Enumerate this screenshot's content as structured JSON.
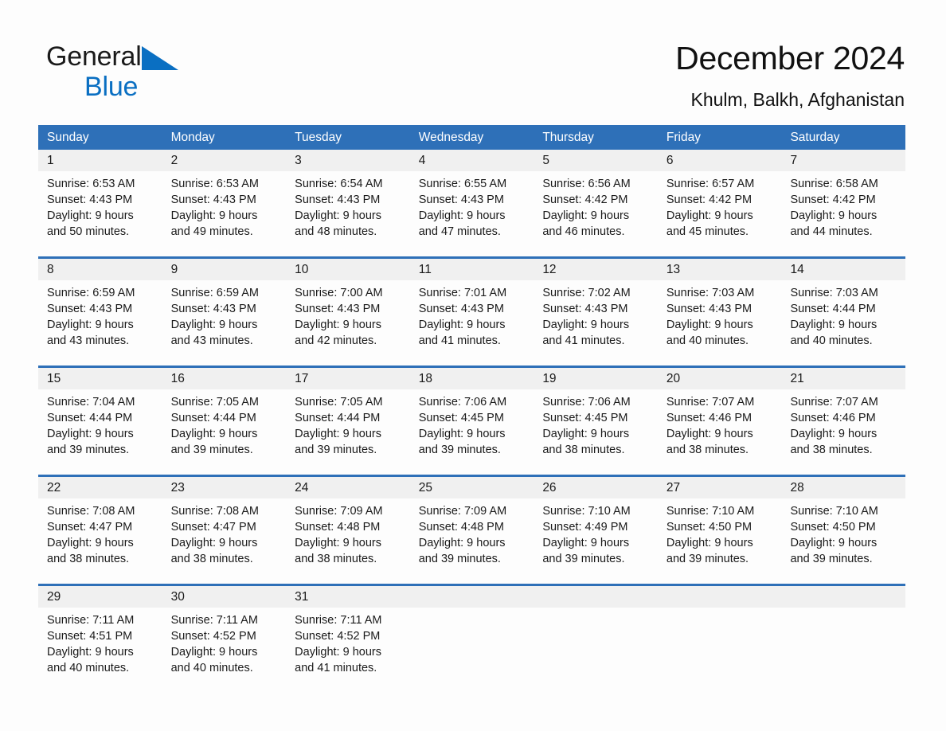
{
  "brand": {
    "name_part1": "General",
    "name_part2": "Blue",
    "triangle_icon": "blue-triangle-icon",
    "accent_color": "#0a6fc2"
  },
  "header": {
    "title": "December 2024",
    "subtitle": "Khulm, Balkh, Afghanistan"
  },
  "theme": {
    "header_blue": "#2e70b8",
    "date_strip_gray": "#f0f0f0",
    "page_background": "#fdfdfd",
    "text_color": "#1a1a1a"
  },
  "calendar": {
    "weekday_headers": [
      "Sunday",
      "Monday",
      "Tuesday",
      "Wednesday",
      "Thursday",
      "Friday",
      "Saturday"
    ],
    "weeks": [
      {
        "days": [
          {
            "date": "1",
            "sunrise": "Sunrise: 6:53 AM",
            "sunset": "Sunset: 4:43 PM",
            "daylight_line1": "Daylight: 9 hours",
            "daylight_line2": "and 50 minutes."
          },
          {
            "date": "2",
            "sunrise": "Sunrise: 6:53 AM",
            "sunset": "Sunset: 4:43 PM",
            "daylight_line1": "Daylight: 9 hours",
            "daylight_line2": "and 49 minutes."
          },
          {
            "date": "3",
            "sunrise": "Sunrise: 6:54 AM",
            "sunset": "Sunset: 4:43 PM",
            "daylight_line1": "Daylight: 9 hours",
            "daylight_line2": "and 48 minutes."
          },
          {
            "date": "4",
            "sunrise": "Sunrise: 6:55 AM",
            "sunset": "Sunset: 4:43 PM",
            "daylight_line1": "Daylight: 9 hours",
            "daylight_line2": "and 47 minutes."
          },
          {
            "date": "5",
            "sunrise": "Sunrise: 6:56 AM",
            "sunset": "Sunset: 4:42 PM",
            "daylight_line1": "Daylight: 9 hours",
            "daylight_line2": "and 46 minutes."
          },
          {
            "date": "6",
            "sunrise": "Sunrise: 6:57 AM",
            "sunset": "Sunset: 4:42 PM",
            "daylight_line1": "Daylight: 9 hours",
            "daylight_line2": "and 45 minutes."
          },
          {
            "date": "7",
            "sunrise": "Sunrise: 6:58 AM",
            "sunset": "Sunset: 4:42 PM",
            "daylight_line1": "Daylight: 9 hours",
            "daylight_line2": "and 44 minutes."
          }
        ]
      },
      {
        "days": [
          {
            "date": "8",
            "sunrise": "Sunrise: 6:59 AM",
            "sunset": "Sunset: 4:43 PM",
            "daylight_line1": "Daylight: 9 hours",
            "daylight_line2": "and 43 minutes."
          },
          {
            "date": "9",
            "sunrise": "Sunrise: 6:59 AM",
            "sunset": "Sunset: 4:43 PM",
            "daylight_line1": "Daylight: 9 hours",
            "daylight_line2": "and 43 minutes."
          },
          {
            "date": "10",
            "sunrise": "Sunrise: 7:00 AM",
            "sunset": "Sunset: 4:43 PM",
            "daylight_line1": "Daylight: 9 hours",
            "daylight_line2": "and 42 minutes."
          },
          {
            "date": "11",
            "sunrise": "Sunrise: 7:01 AM",
            "sunset": "Sunset: 4:43 PM",
            "daylight_line1": "Daylight: 9 hours",
            "daylight_line2": "and 41 minutes."
          },
          {
            "date": "12",
            "sunrise": "Sunrise: 7:02 AM",
            "sunset": "Sunset: 4:43 PM",
            "daylight_line1": "Daylight: 9 hours",
            "daylight_line2": "and 41 minutes."
          },
          {
            "date": "13",
            "sunrise": "Sunrise: 7:03 AM",
            "sunset": "Sunset: 4:43 PM",
            "daylight_line1": "Daylight: 9 hours",
            "daylight_line2": "and 40 minutes."
          },
          {
            "date": "14",
            "sunrise": "Sunrise: 7:03 AM",
            "sunset": "Sunset: 4:44 PM",
            "daylight_line1": "Daylight: 9 hours",
            "daylight_line2": "and 40 minutes."
          }
        ]
      },
      {
        "days": [
          {
            "date": "15",
            "sunrise": "Sunrise: 7:04 AM",
            "sunset": "Sunset: 4:44 PM",
            "daylight_line1": "Daylight: 9 hours",
            "daylight_line2": "and 39 minutes."
          },
          {
            "date": "16",
            "sunrise": "Sunrise: 7:05 AM",
            "sunset": "Sunset: 4:44 PM",
            "daylight_line1": "Daylight: 9 hours",
            "daylight_line2": "and 39 minutes."
          },
          {
            "date": "17",
            "sunrise": "Sunrise: 7:05 AM",
            "sunset": "Sunset: 4:44 PM",
            "daylight_line1": "Daylight: 9 hours",
            "daylight_line2": "and 39 minutes."
          },
          {
            "date": "18",
            "sunrise": "Sunrise: 7:06 AM",
            "sunset": "Sunset: 4:45 PM",
            "daylight_line1": "Daylight: 9 hours",
            "daylight_line2": "and 39 minutes."
          },
          {
            "date": "19",
            "sunrise": "Sunrise: 7:06 AM",
            "sunset": "Sunset: 4:45 PM",
            "daylight_line1": "Daylight: 9 hours",
            "daylight_line2": "and 38 minutes."
          },
          {
            "date": "20",
            "sunrise": "Sunrise: 7:07 AM",
            "sunset": "Sunset: 4:46 PM",
            "daylight_line1": "Daylight: 9 hours",
            "daylight_line2": "and 38 minutes."
          },
          {
            "date": "21",
            "sunrise": "Sunrise: 7:07 AM",
            "sunset": "Sunset: 4:46 PM",
            "daylight_line1": "Daylight: 9 hours",
            "daylight_line2": "and 38 minutes."
          }
        ]
      },
      {
        "days": [
          {
            "date": "22",
            "sunrise": "Sunrise: 7:08 AM",
            "sunset": "Sunset: 4:47 PM",
            "daylight_line1": "Daylight: 9 hours",
            "daylight_line2": "and 38 minutes."
          },
          {
            "date": "23",
            "sunrise": "Sunrise: 7:08 AM",
            "sunset": "Sunset: 4:47 PM",
            "daylight_line1": "Daylight: 9 hours",
            "daylight_line2": "and 38 minutes."
          },
          {
            "date": "24",
            "sunrise": "Sunrise: 7:09 AM",
            "sunset": "Sunset: 4:48 PM",
            "daylight_line1": "Daylight: 9 hours",
            "daylight_line2": "and 38 minutes."
          },
          {
            "date": "25",
            "sunrise": "Sunrise: 7:09 AM",
            "sunset": "Sunset: 4:48 PM",
            "daylight_line1": "Daylight: 9 hours",
            "daylight_line2": "and 39 minutes."
          },
          {
            "date": "26",
            "sunrise": "Sunrise: 7:10 AM",
            "sunset": "Sunset: 4:49 PM",
            "daylight_line1": "Daylight: 9 hours",
            "daylight_line2": "and 39 minutes."
          },
          {
            "date": "27",
            "sunrise": "Sunrise: 7:10 AM",
            "sunset": "Sunset: 4:50 PM",
            "daylight_line1": "Daylight: 9 hours",
            "daylight_line2": "and 39 minutes."
          },
          {
            "date": "28",
            "sunrise": "Sunrise: 7:10 AM",
            "sunset": "Sunset: 4:50 PM",
            "daylight_line1": "Daylight: 9 hours",
            "daylight_line2": "and 39 minutes."
          }
        ]
      },
      {
        "days": [
          {
            "date": "29",
            "sunrise": "Sunrise: 7:11 AM",
            "sunset": "Sunset: 4:51 PM",
            "daylight_line1": "Daylight: 9 hours",
            "daylight_line2": "and 40 minutes."
          },
          {
            "date": "30",
            "sunrise": "Sunrise: 7:11 AM",
            "sunset": "Sunset: 4:52 PM",
            "daylight_line1": "Daylight: 9 hours",
            "daylight_line2": "and 40 minutes."
          },
          {
            "date": "31",
            "sunrise": "Sunrise: 7:11 AM",
            "sunset": "Sunset: 4:52 PM",
            "daylight_line1": "Daylight: 9 hours",
            "daylight_line2": "and 41 minutes."
          },
          {
            "date": "",
            "sunrise": "",
            "sunset": "",
            "daylight_line1": "",
            "daylight_line2": ""
          },
          {
            "date": "",
            "sunrise": "",
            "sunset": "",
            "daylight_line1": "",
            "daylight_line2": ""
          },
          {
            "date": "",
            "sunrise": "",
            "sunset": "",
            "daylight_line1": "",
            "daylight_line2": ""
          },
          {
            "date": "",
            "sunrise": "",
            "sunset": "",
            "daylight_line1": "",
            "daylight_line2": ""
          }
        ]
      }
    ]
  }
}
